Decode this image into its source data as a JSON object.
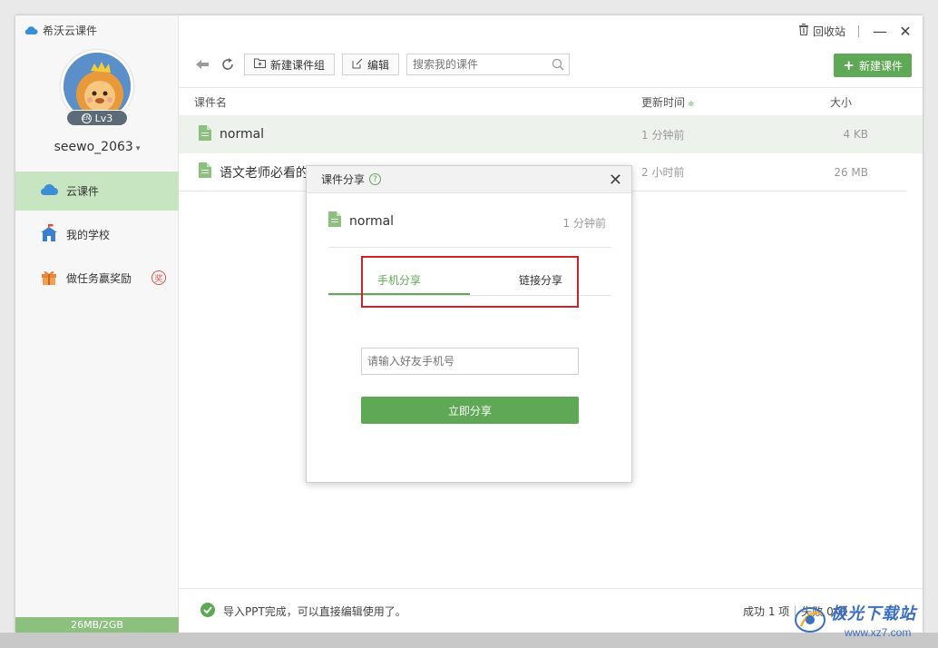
{
  "app": {
    "title": "希沃云课件"
  },
  "titlebar": {
    "recycle_label": "回收站",
    "minimize": "—",
    "close": "✕"
  },
  "sidebar": {
    "level": "Lv3",
    "level_icon_text": "EN",
    "username": "seewo_2063",
    "username_caret": "▾",
    "items": [
      {
        "label": "云课件",
        "icon": "cloud-icon"
      },
      {
        "label": "我的学校",
        "icon": "school-icon"
      },
      {
        "label": "做任务赢奖励",
        "icon": "gift-icon",
        "badge": "奖"
      }
    ],
    "storage": "26MB/2GB"
  },
  "toolbar": {
    "new_group": "新建课件组",
    "edit": "编辑",
    "search_placeholder": "搜索我的课件",
    "new_courseware": "新建课件",
    "new_plus": "+"
  },
  "table": {
    "columns": {
      "name": "课件名",
      "time": "更新时间",
      "time_sort": "≑",
      "size": "大小"
    },
    "rows": [
      {
        "name": "normal",
        "time": "1 分钟前",
        "size": "4 KB"
      },
      {
        "name": "语文老师必看的",
        "time": "2 小时前",
        "size": "26 MB"
      }
    ]
  },
  "status": {
    "message": "导入PPT完成，可以直接编辑使用了。",
    "success": "成功 1 项",
    "fail": "失败 0 项"
  },
  "dialog": {
    "title": "课件分享",
    "help": "?",
    "close": "✕",
    "file_name": "normal",
    "file_time": "1 分钟前",
    "tabs": [
      {
        "label": "手机分享",
        "active": true
      },
      {
        "label": "链接分享",
        "active": false
      }
    ],
    "phone_placeholder": "请输入好友手机号",
    "share_button": "立即分享"
  },
  "watermark": {
    "text": "极光下载站",
    "url": "www.xz7.com"
  },
  "colors": {
    "accent": "#5fa856",
    "highlight": "#d0202a",
    "active_nav": "#c7e5c0"
  }
}
